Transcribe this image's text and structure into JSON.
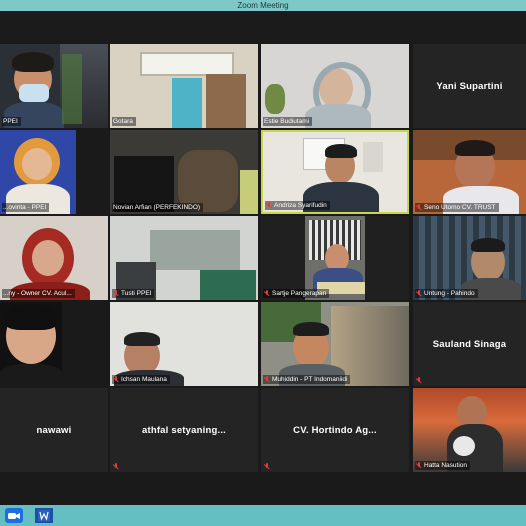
{
  "window": {
    "title": "Zoom Meeting"
  },
  "participants": [
    {
      "id": "p1",
      "label": "PPEI",
      "muted": false
    },
    {
      "id": "p2",
      "label": "Gotara",
      "muted": false
    },
    {
      "id": "p3",
      "label": "Estie Budiutami",
      "muted": false
    },
    {
      "id": "p4",
      "name": "Yani Supartini",
      "muted": false
    },
    {
      "id": "p5",
      "label": "...ovirita - PPEI",
      "muted": false
    },
    {
      "id": "p6",
      "label": "Novian Arfian (PERFEKINDO)",
      "muted": false
    },
    {
      "id": "p7",
      "label": "Andriza Syarifudin",
      "muted": true
    },
    {
      "id": "p8",
      "label": "Seno Utomo CV. TRUST",
      "muted": true
    },
    {
      "id": "p9",
      "label": "...ny - Owner CV. Acul...",
      "muted": false
    },
    {
      "id": "p10",
      "label": "Tusti PPEI",
      "muted": true
    },
    {
      "id": "p11",
      "label": "Sartje Pangerapan",
      "muted": true
    },
    {
      "id": "p12",
      "label": "Untung - Pahindo",
      "muted": true
    },
    {
      "id": "p13",
      "label": "",
      "muted": false
    },
    {
      "id": "p14",
      "label": "Ichsan Maulana",
      "muted": true
    },
    {
      "id": "p15",
      "label": "Muhiddin - PT Indomaniidi",
      "muted": true
    },
    {
      "id": "p16",
      "name": "Sauland Sinaga",
      "muted": true
    },
    {
      "id": "p17",
      "name": "nawawi",
      "muted": false
    },
    {
      "id": "p18",
      "name": "athfal setyaning...",
      "muted": true
    },
    {
      "id": "p19",
      "name": "CV. Hortindo Ag...",
      "muted": true
    },
    {
      "id": "p20",
      "label": "Hatta Nasution",
      "muted": true
    }
  ],
  "taskbar": {
    "icons": [
      "zoom-app-icon",
      "word-app-icon"
    ],
    "accent": "#64bfc2"
  }
}
